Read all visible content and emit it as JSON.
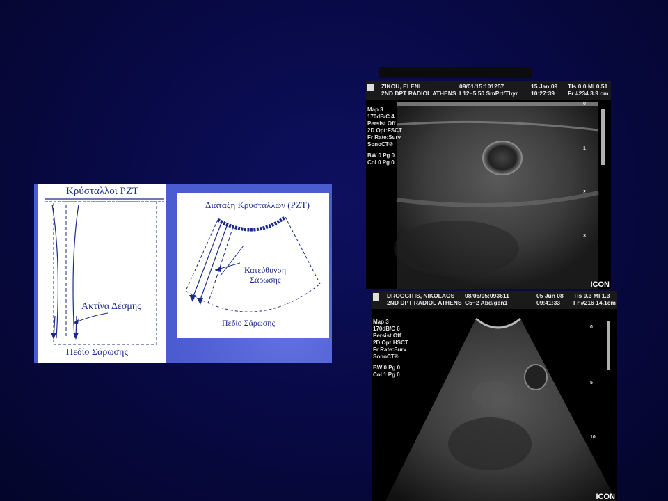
{
  "diagram": {
    "linear_title": "Κρύσταλλοι PZT",
    "linear_beam_label": "Ακτίνα Δέσμης",
    "linear_field_label": "Πεδίο Σάρωσης",
    "sector_title": "Διάταξη Κρυστάλλων (PZT)",
    "sector_direction_line1": "Κατεύθυνση",
    "sector_direction_line2": "Σάρωσης",
    "sector_field_label": "Πεδίο Σάρωσης",
    "colors": {
      "panel": "#4b5bd0",
      "ink": "#1c2a8a"
    }
  },
  "ultrasound_top": {
    "patient": "ZIKOU, ELENI",
    "dept": "2ND DPT RADIOL ATHENS",
    "id": "09/01/15:101257",
    "probe": "L12−5 50 SmPrt/Thyr",
    "date": "15 Jan 09",
    "time": "10:27:39",
    "tis_label": "TIs",
    "tis_value": "0.0",
    "mi_label": "MI",
    "mi_value": "0.51",
    "frame": "Fr #234",
    "depth": "3.9 cm",
    "menu": [
      "Map 3",
      "170dB/C 4",
      "Persist Off",
      "2D Opt:FSCT",
      "Fr Rate:Surv",
      "SonoCT®"
    ],
    "menu2": [
      "BW 0    Pg 0",
      "Col 0    Pg 0"
    ],
    "scale": [
      "0",
      "1",
      "2",
      "3"
    ],
    "brand": "ICON"
  },
  "ultrasound_bottom": {
    "patient": "DROGGITIS, NIKOLAOS",
    "dept": "2ND DPT RADIOL ATHENS",
    "id": "08/06/05:093611",
    "probe": "C5−2 Abd/gen1",
    "date": "05 Jun 08",
    "time": "09:41:33",
    "tis_label": "TIs",
    "tis_value": "0.3",
    "mi_label": "MI",
    "mi_value": "1.3",
    "frame": "Fr #216",
    "depth": "14.1cm",
    "menu": [
      "Map 3",
      "170dB/C 6",
      "Persist Off",
      "2D Opt:HSCT",
      "Fr Rate:Surv",
      "SonoCT®"
    ],
    "menu2": [
      "BW 0    Pg 0",
      "Col 1    Pg 0"
    ],
    "scale": [
      "0",
      "5",
      "10"
    ],
    "brand": "ICON"
  }
}
